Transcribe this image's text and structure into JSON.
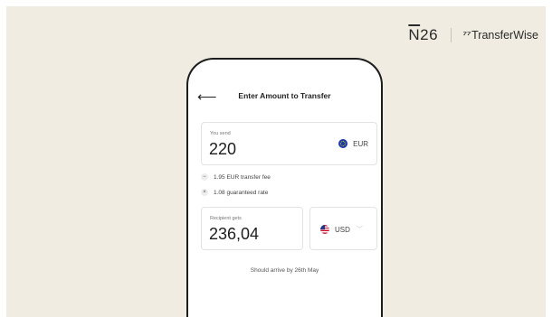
{
  "brand": {
    "n26": "N26",
    "transferwise_mark": "7",
    "transferwise": "TransferWise"
  },
  "screen": {
    "title": "Enter Amount to Transfer",
    "send": {
      "label": "You send",
      "amount": "220",
      "currency": "EUR"
    },
    "fees": [
      {
        "symbol": "−",
        "text": "1.95 EUR transfer fee"
      },
      {
        "symbol": "×",
        "text": "1.08 guaranteed rate"
      }
    ],
    "receive": {
      "label": "Recipient gets",
      "amount": "236,04",
      "currency": "USD"
    },
    "arrival": "Should arrive by 26th May"
  },
  "colors": {
    "background": "#f1ece2",
    "eur_flag": "#1a3ba8",
    "us_red": "#c8102e"
  },
  "icons": {
    "back": "arrow-left-icon",
    "eur": "eu-flag-icon",
    "usd": "us-flag-icon",
    "dropdown": "chevron-down-icon"
  }
}
